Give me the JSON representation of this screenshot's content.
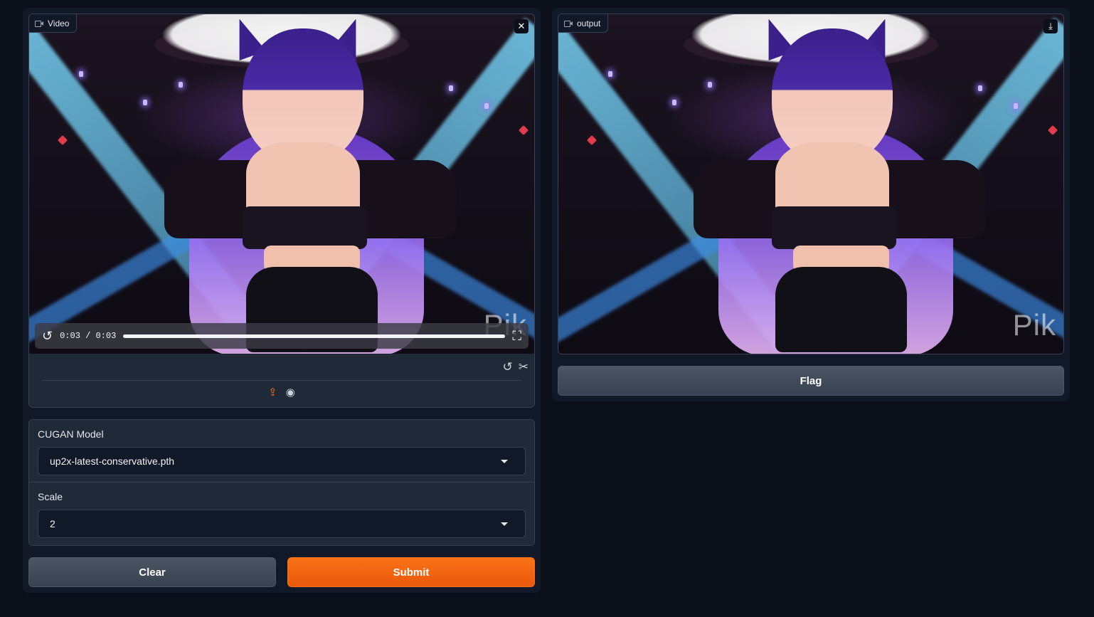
{
  "input_panel": {
    "video_label": "Video",
    "close_icon": "close-icon",
    "player": {
      "time_display": "0:03 / 0:03",
      "progress_fraction": 1.0,
      "watermark": "Pik"
    },
    "toolbar_icons": [
      "undo-icon",
      "scissors-icon",
      "upload-icon",
      "webcam-icon"
    ]
  },
  "params": {
    "model_label": "CUGAN Model",
    "model_value": "up2x-latest-conservative.pth",
    "scale_label": "Scale",
    "scale_value": "2"
  },
  "actions": {
    "clear_label": "Clear",
    "submit_label": "Submit"
  },
  "output_panel": {
    "output_label": "output",
    "download_icon": "download-icon",
    "watermark": "Pik",
    "flag_label": "Flag"
  },
  "colors": {
    "background": "#0b0f19",
    "panel": "#111827",
    "accent": "#f97316",
    "secondary_button": "#4b5563"
  }
}
